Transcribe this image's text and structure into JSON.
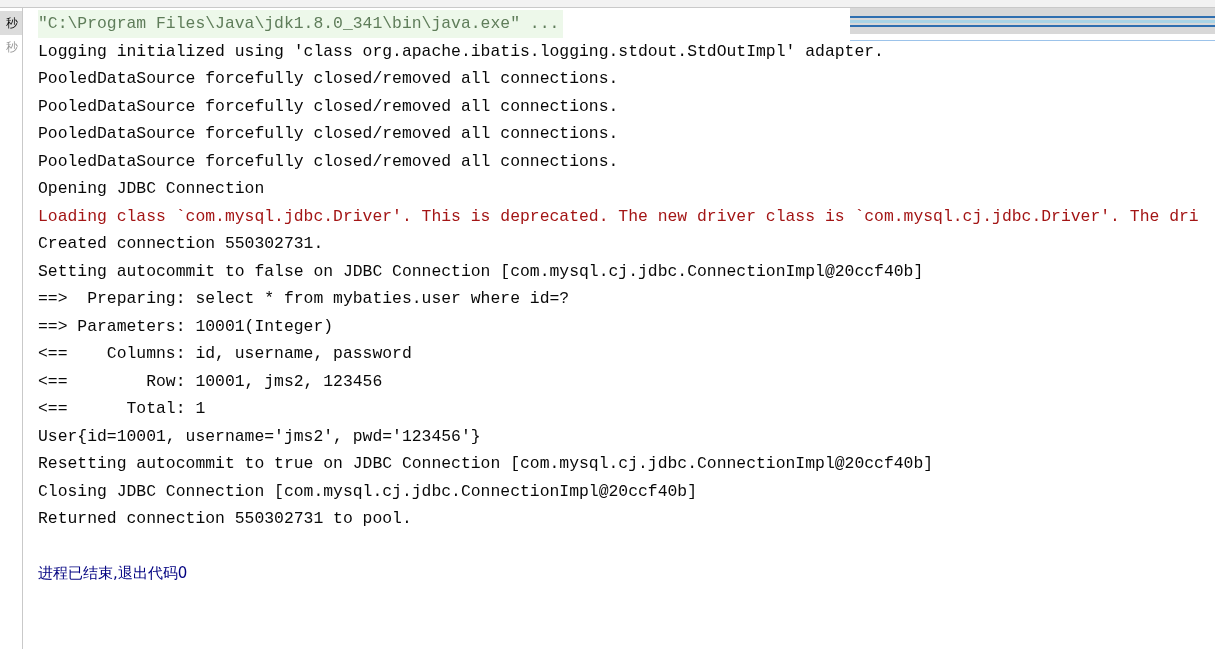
{
  "gutter": [
    {
      "label": "秒",
      "selected": true
    },
    {
      "label": "秒",
      "selected": false
    }
  ],
  "console_lines": [
    {
      "kind": "command",
      "text": "\"C:\\Program Files\\Java\\jdk1.8.0_341\\bin\\java.exe\" ..."
    },
    {
      "kind": "normal",
      "text": "Logging initialized using 'class org.apache.ibatis.logging.stdout.StdOutImpl' adapter."
    },
    {
      "kind": "normal",
      "text": "PooledDataSource forcefully closed/removed all connections."
    },
    {
      "kind": "normal",
      "text": "PooledDataSource forcefully closed/removed all connections."
    },
    {
      "kind": "normal",
      "text": "PooledDataSource forcefully closed/removed all connections."
    },
    {
      "kind": "normal",
      "text": "PooledDataSource forcefully closed/removed all connections."
    },
    {
      "kind": "normal",
      "text": "Opening JDBC Connection"
    },
    {
      "kind": "error",
      "text": "Loading class `com.mysql.jdbc.Driver'. This is deprecated. The new driver class is `com.mysql.cj.jdbc.Driver'. The dri"
    },
    {
      "kind": "normal",
      "text": "Created connection 550302731."
    },
    {
      "kind": "normal",
      "text": "Setting autocommit to false on JDBC Connection [com.mysql.cj.jdbc.ConnectionImpl@20ccf40b]"
    },
    {
      "kind": "normal",
      "text": "==>  Preparing: select * from mybaties.user where id=?"
    },
    {
      "kind": "normal",
      "text": "==> Parameters: 10001(Integer)"
    },
    {
      "kind": "normal",
      "text": "<==    Columns: id, username, password"
    },
    {
      "kind": "normal",
      "text": "<==        Row: 10001, jms2, 123456"
    },
    {
      "kind": "normal",
      "text": "<==      Total: 1"
    },
    {
      "kind": "normal",
      "text": "User{id=10001, username='jms2', pwd='123456'}"
    },
    {
      "kind": "normal",
      "text": "Resetting autocommit to true on JDBC Connection [com.mysql.cj.jdbc.ConnectionImpl@20ccf40b]"
    },
    {
      "kind": "normal",
      "text": "Closing JDBC Connection [com.mysql.cj.jdbc.ConnectionImpl@20ccf40b]"
    },
    {
      "kind": "normal",
      "text": "Returned connection 550302731 to pool."
    },
    {
      "kind": "exit",
      "text": "进程已结束,退出代码0"
    }
  ]
}
